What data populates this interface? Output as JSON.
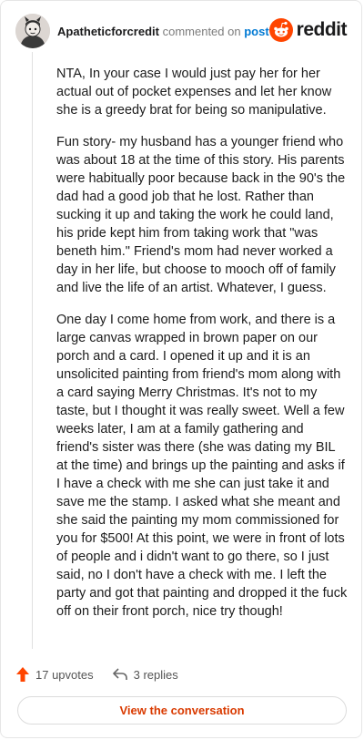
{
  "header": {
    "username": "Apatheticforcredit",
    "action_text": "commented on",
    "target_text": "post",
    "brand_name": "reddit"
  },
  "comment": {
    "paragraphs": [
      "NTA, In your case I would just pay her for her actual out of pocket expenses and let her know she is a greedy brat for being so manipulative.",
      "Fun story- my husband has a younger friend who was about 18 at the time of this story. His parents were habitually poor because back in the 90's the dad had a good job that he lost. Rather than sucking it up and taking the work he could land, his pride kept him from taking work that \"was beneth him.\" Friend's mom had never worked a day in her life, but choose to mooch off of family and live the life of an artist. Whatever, I guess.",
      "One day I come home from work, and there is a large canvas wrapped in brown paper on our porch and a card. I opened it up and it is an unsolicited painting from friend's mom along with a card saying Merry Christmas. It's not to my taste, but I thought it was really sweet. Well a few weeks later, I am at a family gathering and friend's sister was there (she was dating my BIL at the time) and brings up the painting and asks if I have a check with me she can just take it and save me the stamp. I asked what she meant and she said the painting my mom commissioned for you for $500! At this point, we were in front of lots of people and i didn't want to go there, so I just said, no I don't have a check with me. I left the party and got that painting and dropped it the fuck off on their front porch, nice try though!"
    ]
  },
  "actions": {
    "upvotes_label": "17 upvotes",
    "replies_label": "3 replies"
  },
  "footer": {
    "view_button_label": "View the conversation"
  },
  "colors": {
    "upvote_icon": "#ff4500",
    "link_blue": "#0079d3",
    "button_text": "#d93a00",
    "reddit_orange": "#ff4500"
  },
  "icons": {
    "upvote": "upvote-arrow-icon",
    "reply": "reply-arrow-icon",
    "brand": "reddit-snoo-icon"
  }
}
